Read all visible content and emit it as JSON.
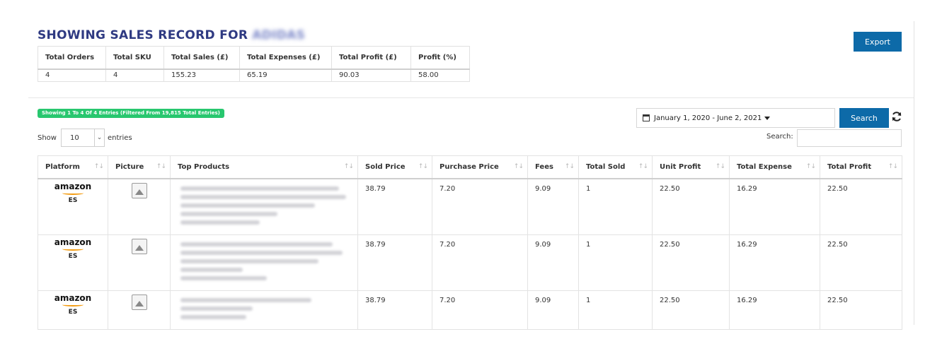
{
  "header": {
    "title_prefix": "SHOWING SALES RECORD FOR",
    "title_store": "ADIDAS",
    "export_label": "Export"
  },
  "summary": {
    "columns": [
      "Total Orders",
      "Total SKU",
      "Total Sales (£)",
      "Total Expenses (£)",
      "Total Profit (£)",
      "Profit (%)"
    ],
    "values": [
      "4",
      "4",
      "155.23",
      "65.19",
      "90.03",
      "58.00"
    ]
  },
  "entries_info": "Showing 1 To 4 Of 4 Entries (Filtered From 19,815 Total Entries)",
  "length_control": {
    "show_label": "Show",
    "value": "10",
    "entries_label": "entries"
  },
  "date_range": "January 1, 2020 - June 2, 2021",
  "search_button": "Search",
  "search": {
    "label": "Search:",
    "value": ""
  },
  "table": {
    "columns": [
      "Platform",
      "Picture",
      "Top Products",
      "Sold Price",
      "Purchase Price",
      "Fees",
      "Total Sold",
      "Unit Profit",
      "Total Expense",
      "Total Profit"
    ],
    "rows": [
      {
        "platform": "amazon",
        "market": "ES",
        "sold_price": "38.79",
        "purchase_price": "7.20",
        "fees": "9.09",
        "total_sold": "1",
        "unit_profit": "22.50",
        "total_expense": "16.29",
        "total_profit": "22.50"
      },
      {
        "platform": "amazon",
        "market": "ES",
        "sold_price": "38.79",
        "purchase_price": "7.20",
        "fees": "9.09",
        "total_sold": "1",
        "unit_profit": "22.50",
        "total_expense": "16.29",
        "total_profit": "22.50"
      },
      {
        "platform": "amazon",
        "market": "ES",
        "sold_price": "38.79",
        "purchase_price": "7.20",
        "fees": "9.09",
        "total_sold": "1",
        "unit_profit": "22.50",
        "total_expense": "16.29",
        "total_profit": "22.50"
      }
    ]
  },
  "colors": {
    "accent": "#0d6aa8",
    "title": "#2f3a82",
    "badge": "#28c76f",
    "amazon_smile": "#f39c12"
  }
}
